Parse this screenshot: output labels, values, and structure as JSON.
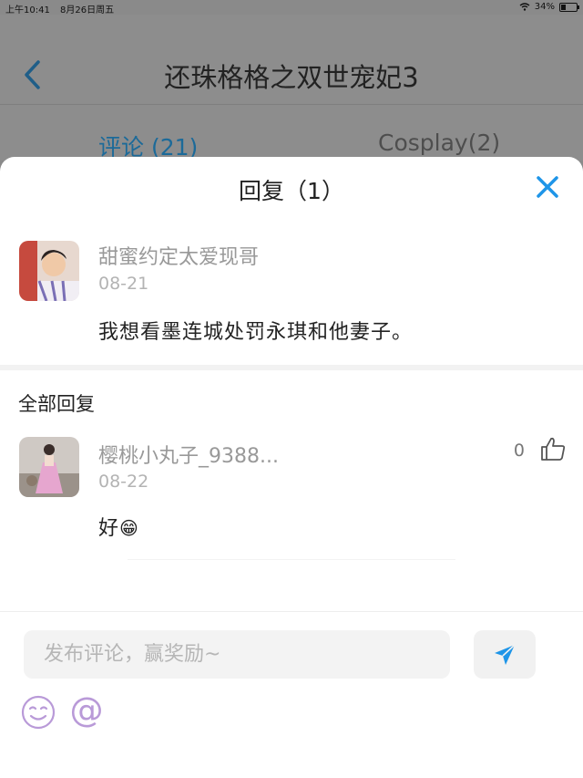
{
  "status_bar": {
    "time": "上午10:41",
    "date": "8月26日周五",
    "battery": "34%",
    "battery_level": 0.34
  },
  "header": {
    "title": "还珠格格之双世宠妃3",
    "tabs": [
      {
        "label": "评论 (21)",
        "active": true
      },
      {
        "label": "Cosplay(2)",
        "active": false
      }
    ]
  },
  "reply_sheet": {
    "title": "回复（1）",
    "original_comment": {
      "username": "甜蜜约定太爱现哥",
      "date": "08-21",
      "content": "我想看墨连城处罚永琪和他妻子。"
    },
    "section_title": "全部回复",
    "replies": [
      {
        "username": "樱桃小丸子_9388...",
        "date": "08-22",
        "content": "好",
        "emoji": "😁",
        "likes": "0"
      }
    ]
  },
  "composer": {
    "placeholder": "发布评论，赢奖励~",
    "at_symbol": "@"
  },
  "colors": {
    "accent": "#1e95e8",
    "tab_active": "#1c6a99",
    "emoji_purple": "#b99ad8"
  }
}
